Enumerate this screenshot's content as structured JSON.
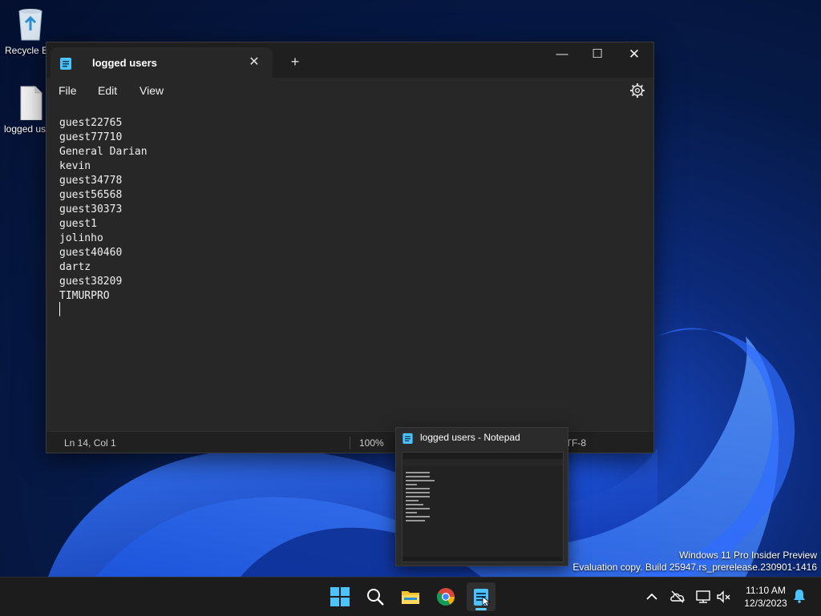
{
  "desktop": {
    "icons": [
      {
        "label": "Recycle Bin"
      },
      {
        "label": "logged users"
      }
    ]
  },
  "notepad": {
    "tab_title": "logged users",
    "menu": [
      "File",
      "Edit",
      "View"
    ],
    "lines": [
      "guest22765",
      "guest77710",
      "General Darian",
      "kevin",
      "guest34778",
      "guest56568",
      "guest30373",
      "guest1",
      "jolinho",
      "guest40460",
      "dartz",
      "guest38209",
      "TIMURPRO"
    ],
    "status": {
      "position": "Ln 14, Col 1",
      "zoom": "100%",
      "encoding": "UTF-8"
    }
  },
  "preview": {
    "title": "logged users - Notepad"
  },
  "watermark": {
    "line1": "Windows 11 Pro Insider Preview",
    "line2": "Evaluation copy. Build 25947.rs_prerelease.230901-1416"
  },
  "taskbar": {
    "time": "11:10 AM",
    "date": "12/3/2023"
  },
  "colors": {
    "accent": "#60cdff",
    "notepad_blue": "#4cc2ff"
  }
}
